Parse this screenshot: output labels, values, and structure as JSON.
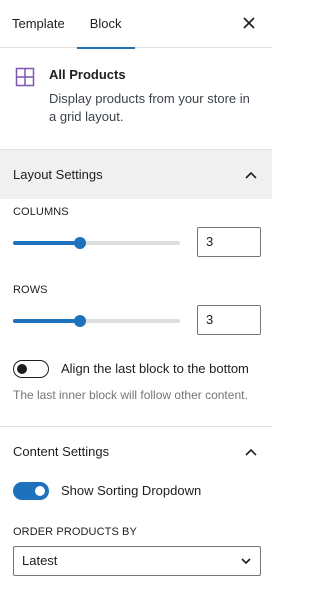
{
  "tabs": [
    {
      "label": "Template",
      "active": false
    },
    {
      "label": "Block",
      "active": true
    }
  ],
  "header": {
    "close_icon": "close-icon"
  },
  "block": {
    "icon": "grid-icon",
    "icon_color": "#7f54b3",
    "title": "All Products",
    "description": "Display products from your store in a grid layout."
  },
  "layout_settings": {
    "title": "Layout Settings",
    "expanded": true,
    "columns": {
      "label": "COLUMNS",
      "value": "3",
      "slider_fraction": 0.5
    },
    "rows": {
      "label": "ROWS",
      "value": "3",
      "slider_fraction": 0.5
    },
    "align_toggle": {
      "label": "Align the last block to the bottom",
      "checked": false,
      "help": "The last inner block will follow other content."
    }
  },
  "content_settings": {
    "title": "Content Settings",
    "expanded": true,
    "sorting_toggle": {
      "label": "Show Sorting Dropdown",
      "checked": true
    },
    "order_by": {
      "label": "ORDER PRODUCTS BY",
      "value": "Latest"
    }
  },
  "colors": {
    "accent": "#1e72bd",
    "tab_indicator": "#2271b1",
    "section_bg": "#f0f0f0"
  }
}
